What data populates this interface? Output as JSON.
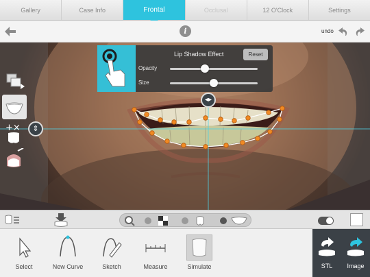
{
  "tabs": [
    {
      "label": "Gallery",
      "state": "normal"
    },
    {
      "label": "Case Info",
      "state": "normal"
    },
    {
      "label": "Frontal",
      "state": "active"
    },
    {
      "label": "Occlusal",
      "state": "disabled"
    },
    {
      "label": "12 O'Clock",
      "state": "normal"
    },
    {
      "label": "Settings",
      "state": "normal"
    }
  ],
  "toolbar": {
    "back_icon": "back-arrow-icon",
    "info_label": "i",
    "undo_label": "undo",
    "undo_icon": "undo-icon",
    "redo_icon": "redo-icon"
  },
  "effect_panel": {
    "title": "Lip Shadow Effect",
    "reset_label": "Reset",
    "opacity_label": "Opacity",
    "opacity_value": 0.4,
    "size_label": "Size",
    "size_value": 0.5,
    "icon": "touch-gesture-icon"
  },
  "left_tools": [
    "image-swap-icon",
    "smile-icon",
    "add-remove-tooth-icon",
    "tooth-color-icon"
  ],
  "mid_strip": {
    "left_icon": "tooth-list-icon",
    "download_icon": "tooth-download-icon",
    "pill_icons": [
      "magnifier-icon",
      "contrast-icon",
      "single-tooth-icon",
      "teeth-arch-icon"
    ],
    "toggle_state": "on"
  },
  "bottom_tools": [
    {
      "label": "Select",
      "icon": "cursor-icon"
    },
    {
      "label": "New Curve",
      "icon": "curve-icon"
    },
    {
      "label": "Sketch",
      "icon": "sketch-icon"
    },
    {
      "label": "Measure",
      "icon": "ruler-icon"
    },
    {
      "label": "Simulate",
      "icon": "simulate-tooth-icon",
      "active": true
    }
  ],
  "export_tools": [
    {
      "label": "STL",
      "icon": "stl-export-icon"
    },
    {
      "label": "Image",
      "icon": "image-export-icon"
    }
  ],
  "colors": {
    "accent": "#2ec3de",
    "curve_point": "#f08a24",
    "guide_line": "#4fd3e8",
    "panel_bg": "#3a3a3a",
    "export_bg": "#3b4147"
  }
}
